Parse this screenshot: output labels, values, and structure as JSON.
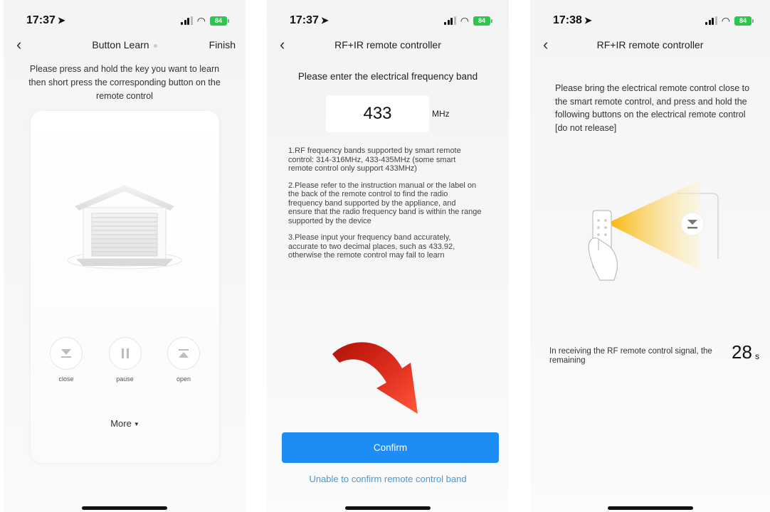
{
  "screens": [
    {
      "time": "17:37",
      "battery": "84",
      "nav_title": "Button Learn",
      "nav_right": "Finish",
      "instruction": "Please press and hold the key you want to learn then short press the corresponding button on the remote control",
      "controls": [
        {
          "label": "close",
          "icon": "close-down-icon"
        },
        {
          "label": "pause",
          "icon": "pause-icon"
        },
        {
          "label": "open",
          "icon": "open-up-icon"
        }
      ],
      "more_label": "More"
    },
    {
      "time": "17:37",
      "battery": "84",
      "nav_title": "RF+IR remote controller",
      "heading": "Please enter the electrical frequency band",
      "frequency_value": "433",
      "frequency_unit": "MHz",
      "notes": [
        "1.RF frequency bands supported by smart remote control: 314-316MHz, 433-435MHz (some smart remote control only support 433MHz)",
        "2.Please refer to the instruction manual or the label on the back of the remote control to find the radio frequency band supported by the appliance, and ensure that the radio frequency band is within the range supported by the device",
        "3.Please input your frequency band accurately, accurate to two decimal places, such as 433.92, otherwise the remote control may fail to learn"
      ],
      "confirm_label": "Confirm",
      "unable_label": "Unable to confirm remote control band"
    },
    {
      "time": "17:38",
      "battery": "84",
      "nav_title": "RF+IR remote controller",
      "instruction": "Please bring the electrical remote control close to the smart remote control, and press and hold the following buttons on the electrical remote control [do not release]",
      "countdown_text": "In receiving the RF remote control signal, the remaining",
      "countdown_value": "28",
      "countdown_unit": "s"
    }
  ],
  "colors": {
    "accent_blue": "#1d8cf5",
    "link_blue": "#4a97d6",
    "battery_green": "#2fc64f",
    "beam_yellow": "#f7b300",
    "arrow_red": "#d8231a"
  }
}
